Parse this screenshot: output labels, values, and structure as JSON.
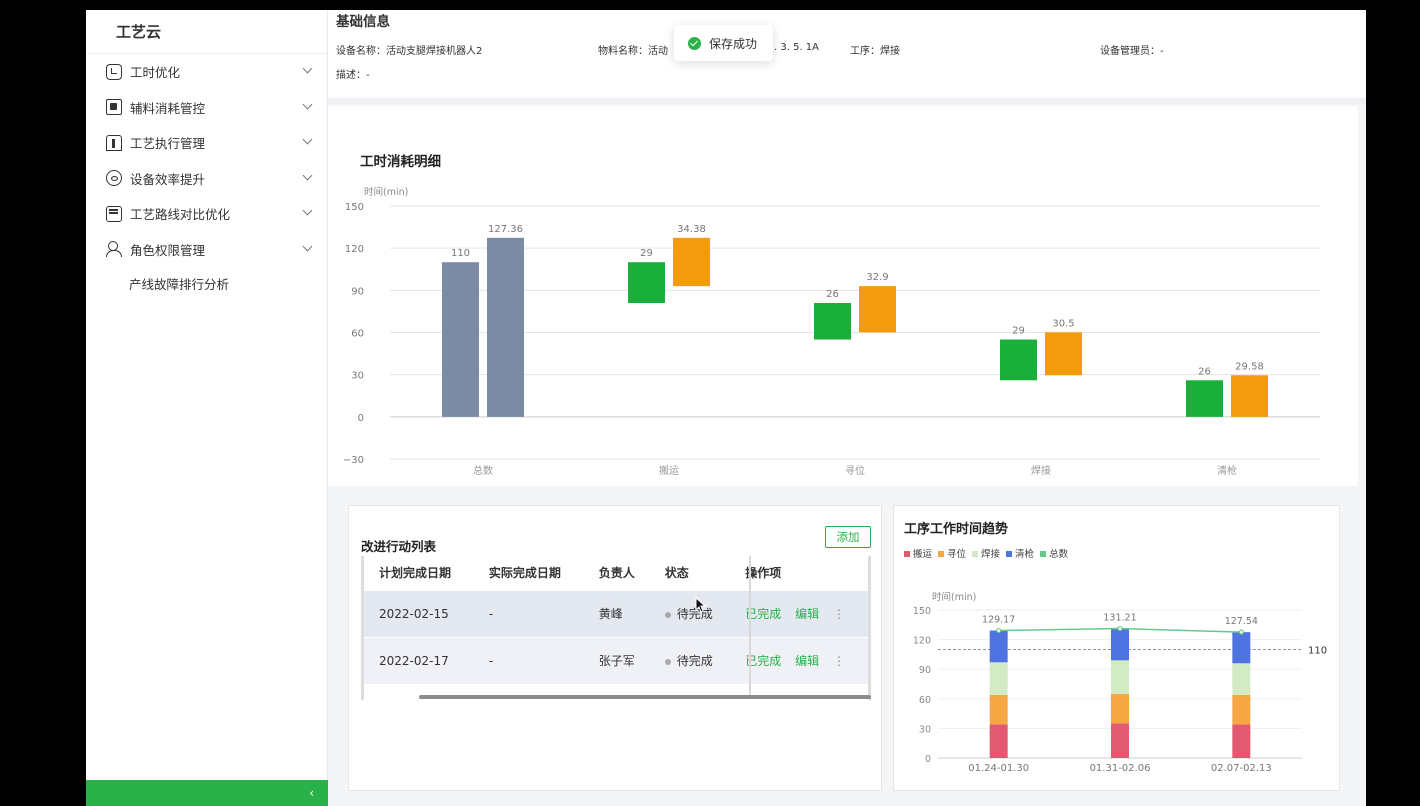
{
  "app": {
    "name": "工艺云"
  },
  "sidebar": {
    "items": [
      {
        "label": "工时优化",
        "icon": "clock-icon"
      },
      {
        "label": "辅料消耗管控",
        "icon": "material-icon"
      },
      {
        "label": "工艺执行管理",
        "icon": "execution-icon"
      },
      {
        "label": "设备效率提升",
        "icon": "gauge-icon"
      },
      {
        "label": "工艺路线对比优化",
        "icon": "route-icon"
      },
      {
        "label": "角色权限管理",
        "icon": "user-group-icon"
      }
    ],
    "sub_item": "产线故障排行分析",
    "collapse_glyph": "‹"
  },
  "info": {
    "title": "基础信息",
    "device_name": "设备名称：活动支腿焊接机器人2",
    "material_name": "物料名称：活动",
    "version_fragment": ". 3. 5. 1A",
    "process": "工序：焊接",
    "admin": "设备管理员：-",
    "description": "描述：-"
  },
  "toast": {
    "text": "保存成功"
  },
  "waterfall": {
    "title": "工时消耗明细",
    "ylabel": "时间(min)"
  },
  "actions": {
    "title": "改进行动列表",
    "add_label": "添加",
    "columns": [
      "计划完成日期",
      "实际完成日期",
      "负责人",
      "状态",
      "操作项"
    ],
    "rows": [
      {
        "planned": "2022-02-15",
        "actual": "-",
        "owner": "黄峰",
        "status": "待完成",
        "complete": "已完成",
        "edit": "编辑",
        "more": "⋮"
      },
      {
        "planned": "2022-02-17",
        "actual": "-",
        "owner": "张子军",
        "status": "待完成",
        "complete": "已完成",
        "edit": "编辑",
        "more": "⋮"
      }
    ]
  },
  "trend": {
    "title": "工序工作时间趋势",
    "legend": [
      "搬运",
      "寻位",
      "焊接",
      "清枪",
      "总数"
    ],
    "ylabel": "时间(min)",
    "reference_label": "110"
  },
  "colors": {
    "brand_green": "#2ab24a",
    "total_bar": "#7a8ba3",
    "standard_bar": "#1aaf3a",
    "actual_bar": "#f29b0d",
    "stack_move": "#e15a72",
    "stack_locate": "#f4a742",
    "stack_weld": "#d2ebc4",
    "stack_clean": "#4f73e0",
    "stack_total": "#66c98a"
  },
  "chart_data": [
    {
      "type": "bar",
      "title": "工时消耗明细",
      "ylabel": "时间(min)",
      "ylim": [
        -30,
        150
      ],
      "yticks": [
        -30,
        0,
        30,
        60,
        90,
        120,
        150
      ],
      "categories": [
        "总数",
        "搬运",
        "寻位",
        "焊接",
        "清枪"
      ],
      "series": [
        {
          "values": [
            110,
            29,
            26,
            29,
            26
          ],
          "ranges": [
            [
              0,
              110
            ],
            [
              81,
              110
            ],
            [
              55,
              81
            ],
            [
              26,
              55
            ],
            [
              0,
              26
            ]
          ]
        },
        {
          "values": [
            127.36,
            34.38,
            32.9,
            30.5,
            29.58
          ],
          "ranges": [
            [
              0,
              127.36
            ],
            [
              93,
              127.36
            ],
            [
              60.1,
              93
            ],
            [
              29.6,
              60.1
            ],
            [
              0,
              29.58
            ]
          ]
        }
      ]
    },
    {
      "type": "bar",
      "stacked": true,
      "title": "工序工作时间趋势",
      "ylabel": "时间(min)",
      "ylim": [
        0,
        150
      ],
      "yticks": [
        0,
        30,
        60,
        90,
        120,
        150
      ],
      "categories": [
        "01.24-01.30",
        "01.31-02.06",
        "02.07-02.13"
      ],
      "series": [
        {
          "name": "搬运",
          "values": [
            34,
            35,
            34
          ]
        },
        {
          "name": "寻位",
          "values": [
            30,
            30,
            30
          ]
        },
        {
          "name": "焊接",
          "values": [
            33,
            34,
            32
          ]
        },
        {
          "name": "清枪",
          "values": [
            32.17,
            32.21,
            31.54
          ]
        },
        {
          "name": "总数",
          "type": "line",
          "values": [
            129.17,
            131.21,
            127.54
          ]
        }
      ],
      "reference_line": 110
    }
  ]
}
